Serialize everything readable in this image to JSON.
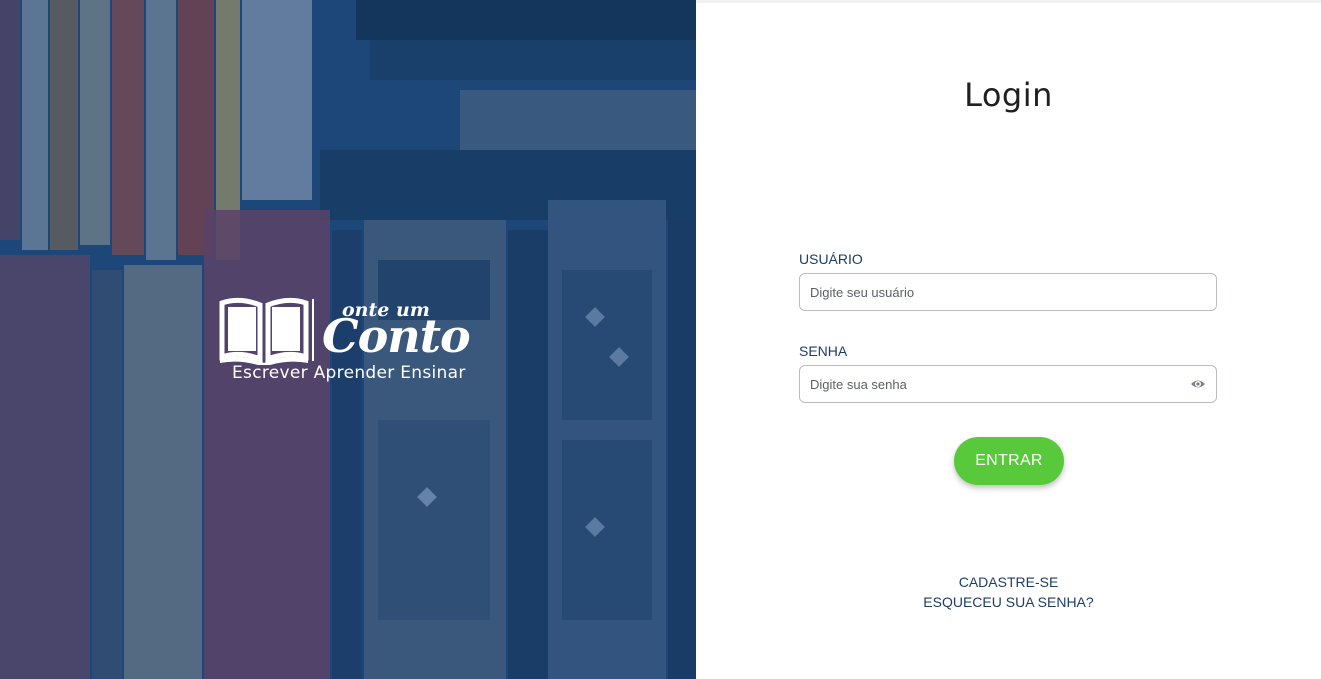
{
  "hero": {
    "brand_top": "onte um",
    "brand_main": "Conto",
    "tagline": "Escrever Aprender Ensinar"
  },
  "login": {
    "title": "Login",
    "username_label": "USUÁRIO",
    "username_placeholder": "Digite seu usuário",
    "username_value": "",
    "password_label": "SENHA",
    "password_placeholder": "Digite sua senha",
    "password_value": "",
    "password_toggle_icon": "eye-icon",
    "submit_label": "ENTRAR",
    "signup_link": "CADASTRE-SE",
    "forgot_link": "ESQUECEU SUA SENHA?"
  },
  "colors": {
    "primary_text": "#1e3d66",
    "submit_button": "#58c93a",
    "hero_overlay": "#1f4a7a"
  }
}
